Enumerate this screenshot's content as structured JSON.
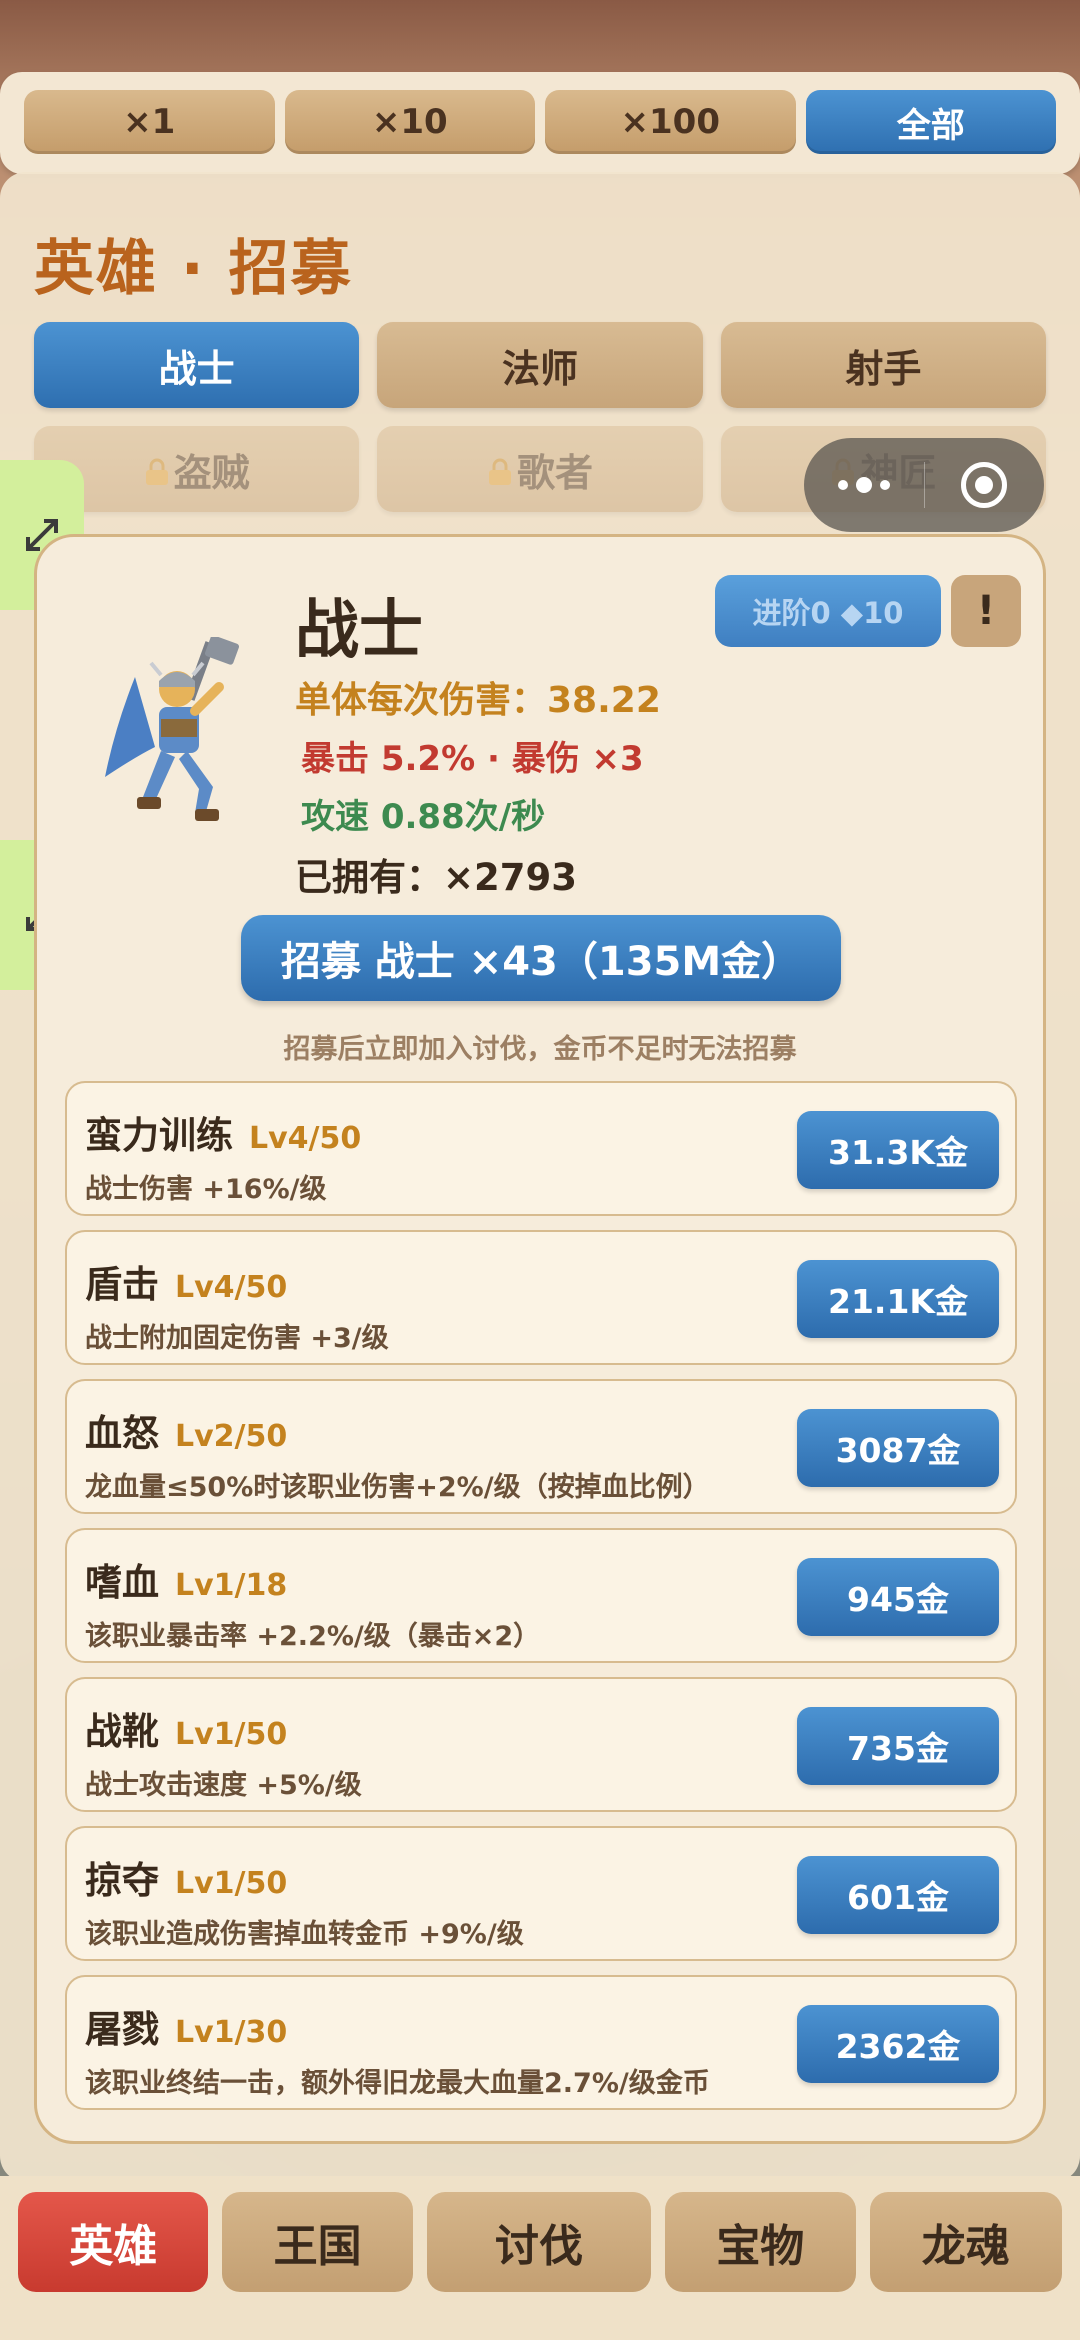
{
  "multipliers": [
    {
      "label": "×1",
      "active": false
    },
    {
      "label": "×10",
      "active": false
    },
    {
      "label": "×100",
      "active": false
    },
    {
      "label": "全部",
      "active": true
    }
  ],
  "page_title": "英雄 · 招募",
  "class_tabs": [
    {
      "label": "战士",
      "active": true,
      "locked": false
    },
    {
      "label": "法师",
      "active": false,
      "locked": false
    },
    {
      "label": "射手",
      "active": false,
      "locked": false
    },
    {
      "label": "盗贼",
      "active": false,
      "locked": true
    },
    {
      "label": "歌者",
      "active": false,
      "locked": true
    },
    {
      "label": "神匠",
      "active": false,
      "locked": true
    }
  ],
  "hero": {
    "name": "战士",
    "advance_label": "进阶0 ◆10",
    "info_label": "!",
    "damage": "单体每次伤害：38.22",
    "crit": "暴击 5.2% · 暴伤 ×3",
    "speed": "攻速 0.88次/秒",
    "owned": "已拥有：×2793",
    "recruit_label": "招募 战士 ×43（135M金）",
    "recruit_hint": "招募后立即加入讨伐，金币不足时无法招募"
  },
  "skills": [
    {
      "name": "蛮力训练",
      "level": "Lv4/50",
      "desc": "战士伤害 +16%/级",
      "cost": "31.3K金"
    },
    {
      "name": "盾击",
      "level": "Lv4/50",
      "desc": "战士附加固定伤害 +3/级",
      "cost": "21.1K金"
    },
    {
      "name": "血怒",
      "level": "Lv2/50",
      "desc": "龙血量≤50%时该职业伤害+2%/级（按掉血比例）",
      "cost": "3087金"
    },
    {
      "name": "嗜血",
      "level": "Lv1/18",
      "desc": "该职业暴击率 +2.2%/级（暴击×2）",
      "cost": "945金"
    },
    {
      "name": "战靴",
      "level": "Lv1/50",
      "desc": "战士攻击速度 +5%/级",
      "cost": "735金"
    },
    {
      "name": "掠夺",
      "level": "Lv1/50",
      "desc": "该职业造成伤害掉血转金币 +9%/级",
      "cost": "601金"
    },
    {
      "name": "屠戮",
      "level": "Lv1/30",
      "desc": "该职业终结一击，额外得旧龙最大血量2.7%/级金币",
      "cost": "2362金"
    }
  ],
  "bottom_nav": [
    {
      "label": "英雄",
      "active": true
    },
    {
      "label": "王国",
      "active": false
    },
    {
      "label": "讨伐",
      "active": false
    },
    {
      "label": "宝物",
      "active": false
    },
    {
      "label": "龙魂",
      "active": false
    }
  ],
  "colors": {
    "accent_blue": "#3a7fc2",
    "active_red": "#d6473b",
    "title_orange": "#b9631d",
    "side_tab_green": "#d3ef9c"
  },
  "icons": {
    "lock": "lock-icon",
    "expand": "expand-icon",
    "more": "more-dots-icon",
    "close": "capsule-close-icon",
    "hero": "warrior-portrait"
  }
}
